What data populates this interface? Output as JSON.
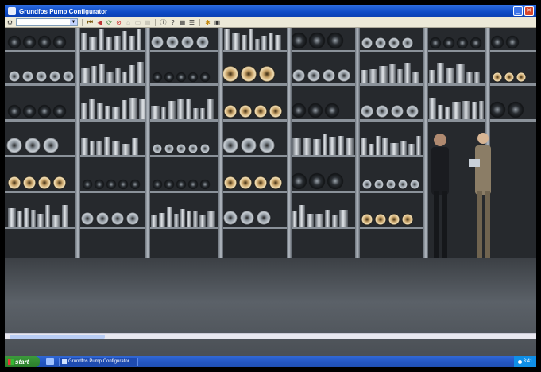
{
  "window": {
    "title": "Grundfos Pump Configurator"
  },
  "toolbar": {
    "dropdown_value": "",
    "icons": [
      "config-icon",
      "first-icon",
      "prev-icon",
      "refresh-icon",
      "stop-icon",
      "home-icon",
      "doc-icon",
      "print-icon",
      "info-icon",
      "help-icon",
      "grid-icon",
      "list-icon",
      "settings-icon"
    ]
  },
  "scene": {
    "description_icons": [
      "warehouse-shelves",
      "business-people"
    ]
  },
  "taskbar": {
    "start_label": "start",
    "task_label": "Grundfos Pump Configurator",
    "clock": "3:41"
  },
  "colors": {
    "titlebar": "#0b48c4",
    "taskbar": "#2457c4",
    "start": "#2b7d2b",
    "toolbar": "#ece9d8"
  }
}
